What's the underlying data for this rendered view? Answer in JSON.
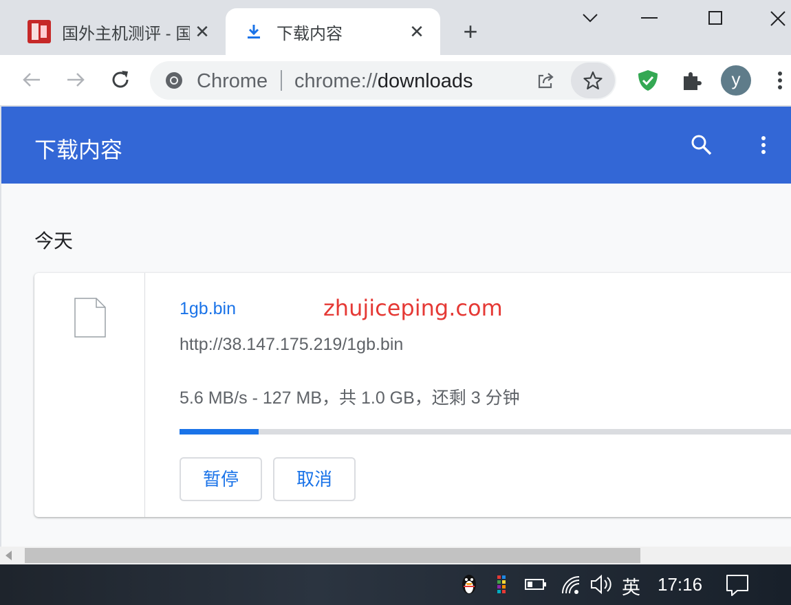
{
  "tabs": [
    {
      "title": "国外主机测评 - 国",
      "active": false,
      "close": "✕"
    },
    {
      "title": "下载内容",
      "active": true,
      "close": "✕"
    }
  ],
  "new_tab": "+",
  "toolbar": {
    "site_chip": "Chrome",
    "url_scheme": "chrome://",
    "url_path": "downloads",
    "avatar_letter": "y"
  },
  "downloads_page": {
    "title": "下载内容",
    "section_date": "今天",
    "items": [
      {
        "file_name": "1gb.bin",
        "url": "http://38.147.175.219/1gb.bin",
        "status": "5.6 MB/s - 127 MB，共 1.0 GB，还剩 3 分钟",
        "progress_fraction": 0.127,
        "pause_label": "暂停",
        "cancel_label": "取消"
      }
    ]
  },
  "watermark": "zhujiceping.com",
  "taskbar": {
    "ime": "英",
    "clock": "17:16"
  },
  "colors": {
    "header_blue": "#3367d6",
    "link_blue": "#1a73e8",
    "watermark_red": "#e53935",
    "shield_green": "#34a853"
  }
}
